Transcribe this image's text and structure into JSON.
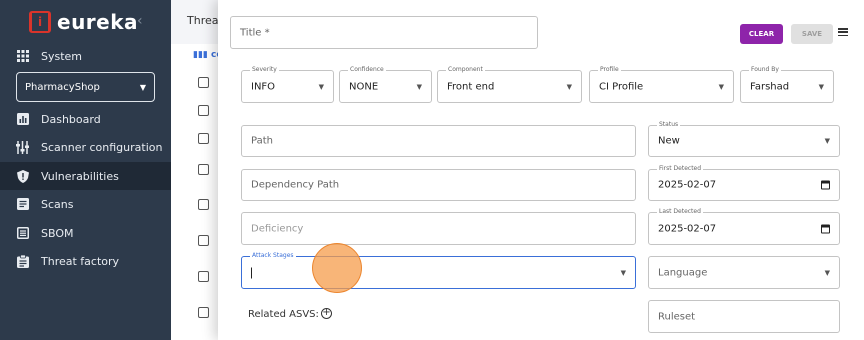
{
  "app": {
    "logo_mark": "i",
    "logo_text": "eureka"
  },
  "sidebar": {
    "section_label": "System",
    "project": "PharmacyShop",
    "items": [
      {
        "label": "Dashboard",
        "icon": "bar-chart-icon"
      },
      {
        "label": "Scanner configuration",
        "icon": "sliders-icon"
      },
      {
        "label": "Vulnerabilities",
        "icon": "shield-icon",
        "active": true
      },
      {
        "label": "Scans",
        "icon": "document-icon"
      },
      {
        "label": "SBOM",
        "icon": "list-box-icon"
      },
      {
        "label": "Threat factory",
        "icon": "clipboard-icon"
      }
    ]
  },
  "background": {
    "header": "Threat",
    "column_hint": "co"
  },
  "modal": {
    "title_placeholder": "Title *",
    "clear_label": "CLEAR",
    "save_label": "SAVE",
    "severity": {
      "label": "Severity",
      "value": "INFO"
    },
    "confidence": {
      "label": "Confidence",
      "value": "NONE"
    },
    "component": {
      "label": "Component",
      "value": "Front end"
    },
    "profile": {
      "label": "Profile",
      "value": "CI Profile"
    },
    "found_by": {
      "label": "Found By",
      "value": "Farshad"
    },
    "path_placeholder": "Path",
    "dependency_path_placeholder": "Dependency Path",
    "deficiency_placeholder": "Deficiency",
    "attack_stages": {
      "label": "Attack Stages",
      "value": ""
    },
    "status": {
      "label": "Status",
      "value": "New"
    },
    "first_detected": {
      "label": "First Detected",
      "value": "2025-02-07"
    },
    "last_detected": {
      "label": "Last Detected",
      "value": "2025-02-07"
    },
    "language_placeholder": "Language",
    "ruleset_placeholder": "Ruleset",
    "related_asvs_label": "Related ASVS:"
  },
  "colors": {
    "sidebar": "#2d3a4b",
    "accent_purple": "#8e24aa",
    "focus_blue": "#3a6fd8",
    "logo_red": "#d9342b"
  }
}
